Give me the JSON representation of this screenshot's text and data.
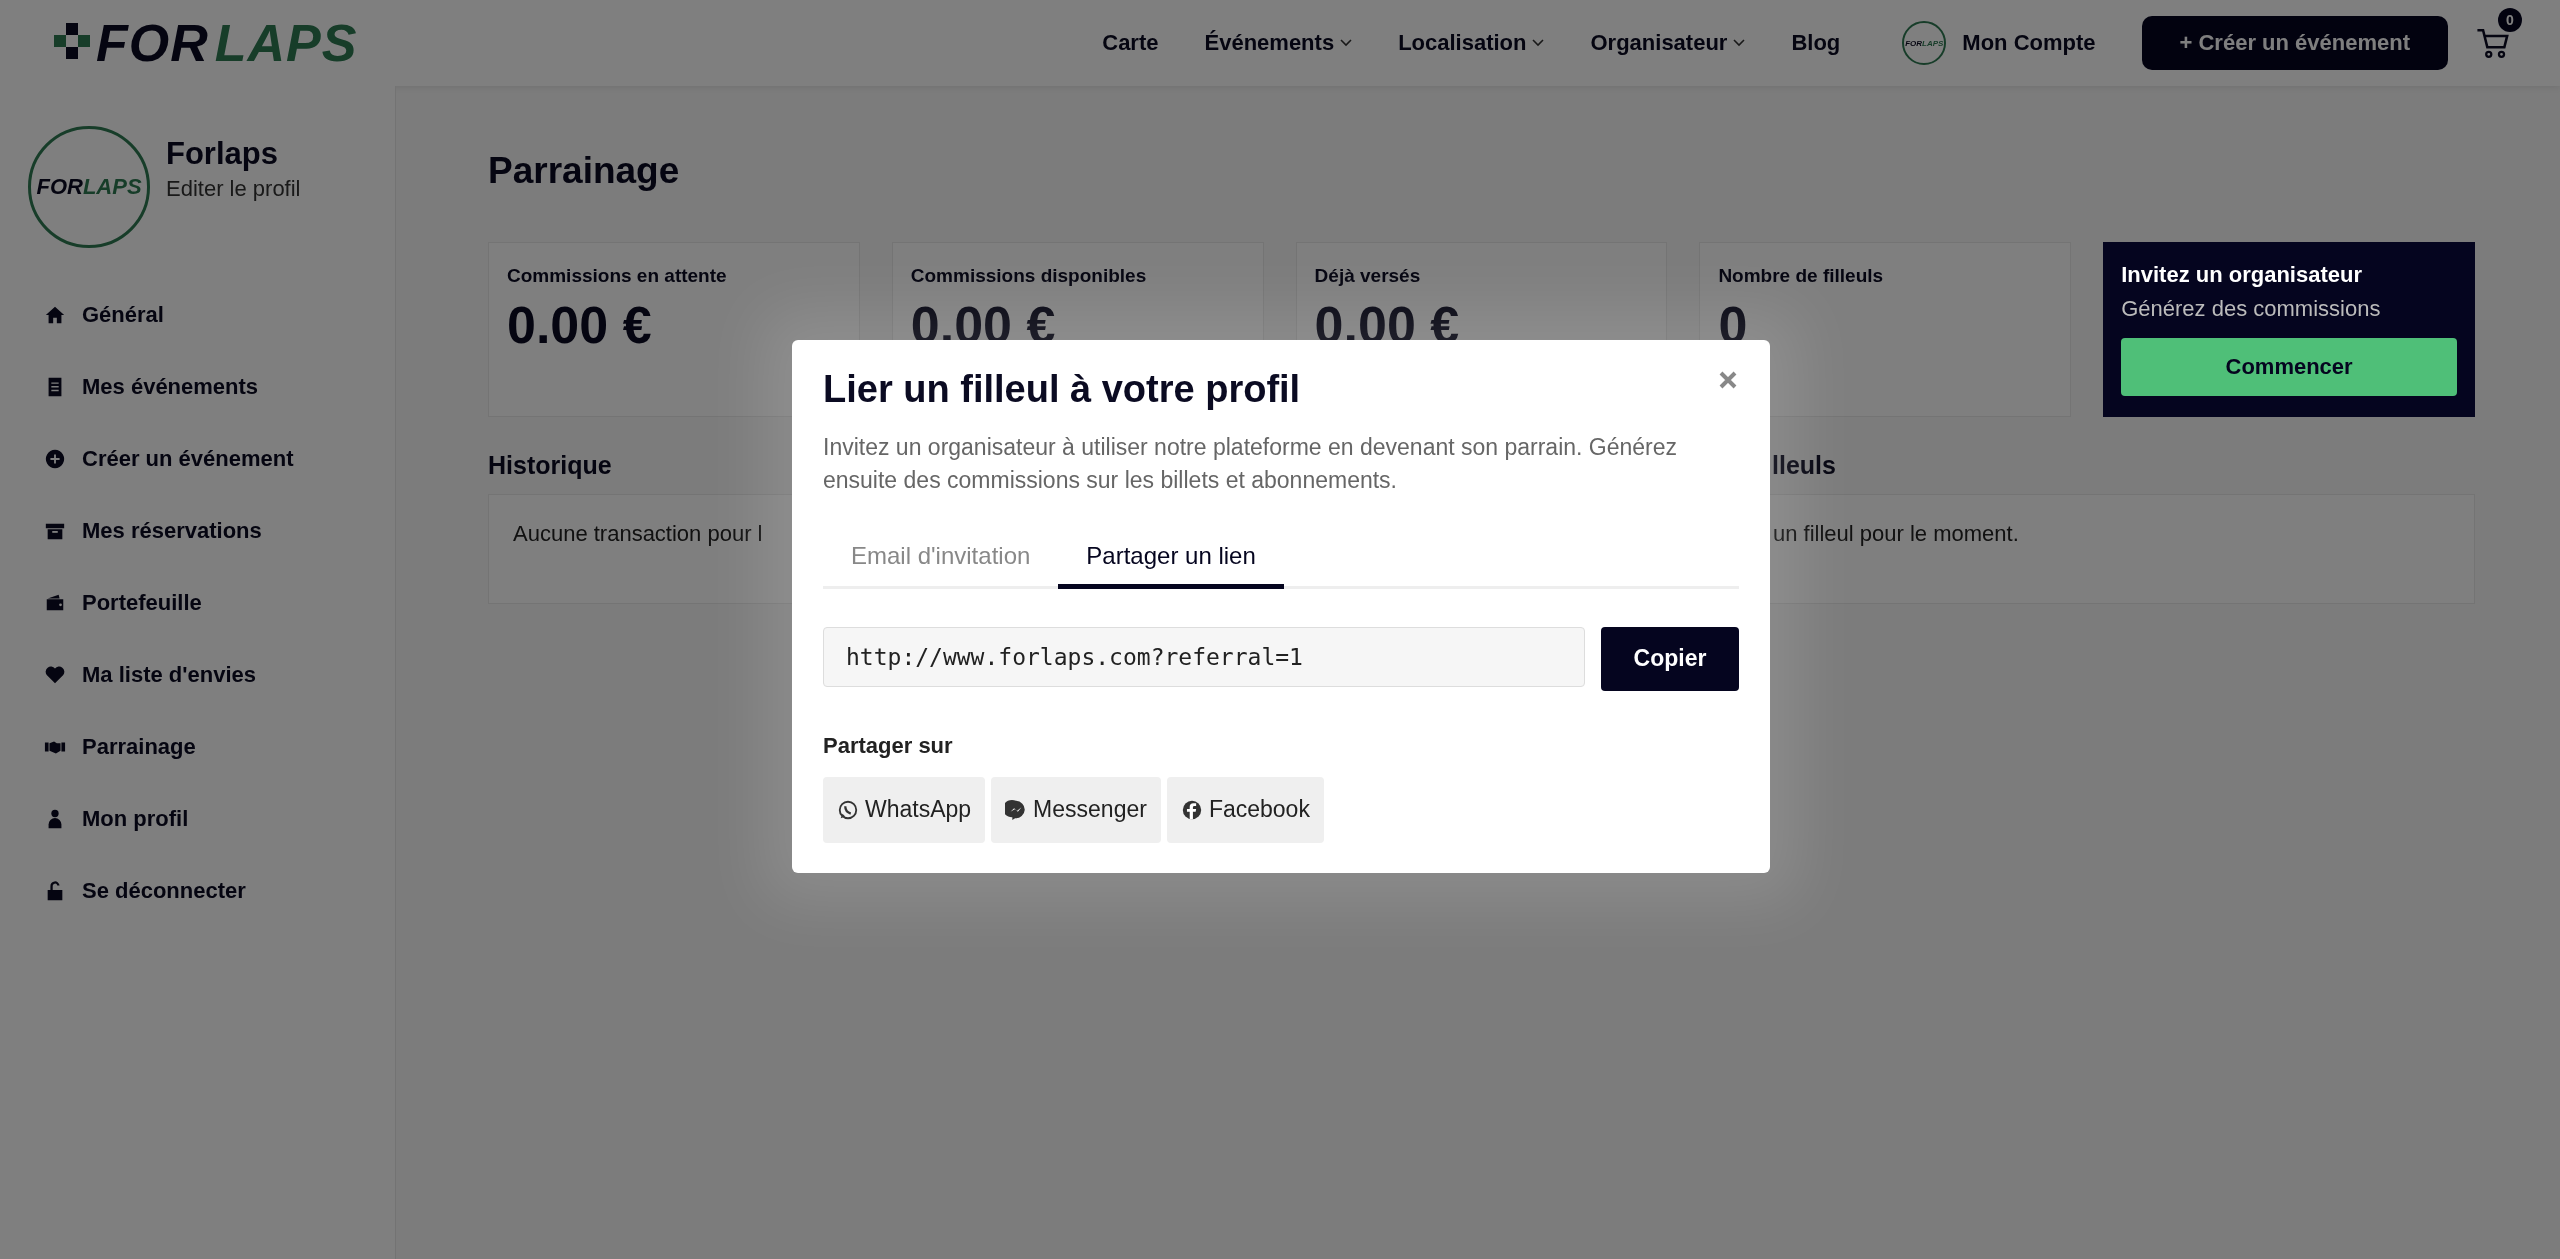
{
  "header": {
    "logo": [
      "FOR",
      "LAPS"
    ],
    "nav": [
      {
        "label": "Carte",
        "dropdown": false
      },
      {
        "label": "Événements",
        "dropdown": true
      },
      {
        "label": "Localisation",
        "dropdown": true
      },
      {
        "label": "Organisateur",
        "dropdown": true
      },
      {
        "label": "Blog",
        "dropdown": false
      }
    ],
    "account": {
      "logo": [
        "FOR",
        "LAPS"
      ],
      "label": "Mon Compte"
    },
    "create_button": "+ Créer un événement",
    "cart_count": "0"
  },
  "sidebar": {
    "avatar_logo": [
      "FOR",
      "LAPS"
    ],
    "name": "Forlaps",
    "edit_link": "Editer le profil",
    "items": [
      {
        "label": "Général"
      },
      {
        "label": "Mes événements"
      },
      {
        "label": "Créer un événement"
      },
      {
        "label": "Mes réservations"
      },
      {
        "label": "Portefeuille"
      },
      {
        "label": "Ma liste d'envies"
      },
      {
        "label": "Parrainage"
      },
      {
        "label": "Mon profil"
      },
      {
        "label": "Se déconnecter"
      }
    ]
  },
  "page": {
    "title": "Parrainage",
    "stats": [
      {
        "label": "Commissions en attente",
        "value": "0.00 €"
      },
      {
        "label": "Commissions disponibles",
        "value": "0.00 €"
      },
      {
        "label": "Déjà versés",
        "value": "0.00 €"
      },
      {
        "label": "Nombre de filleuls",
        "value": "0"
      }
    ],
    "invite_card": {
      "title": "Invitez un organisateur",
      "subtitle": "Générez des commissions",
      "button": "Commencer"
    },
    "history": {
      "title": "Historique",
      "empty": "Aucune transaction pour l"
    },
    "referrals": {
      "title": "lleuls",
      "empty": "un filleul pour le moment."
    }
  },
  "modal": {
    "title": "Lier un filleul à votre profil",
    "description": "Invitez un organisateur à utiliser notre plateforme en devenant son parrain. Générez ensuite des commissions sur les billets et abonnements.",
    "tabs": [
      {
        "label": "Email d'invitation",
        "selected": false
      },
      {
        "label": "Partager un lien",
        "selected": true
      }
    ],
    "link_value": "http://www.forlaps.com?referral=1",
    "copy_button": "Copier",
    "share_label": "Partager sur",
    "share_buttons": [
      {
        "label": "WhatsApp",
        "kind": "whatsapp"
      },
      {
        "label": "Messenger",
        "kind": "messenger"
      },
      {
        "label": "Facebook",
        "kind": "facebook"
      }
    ]
  }
}
